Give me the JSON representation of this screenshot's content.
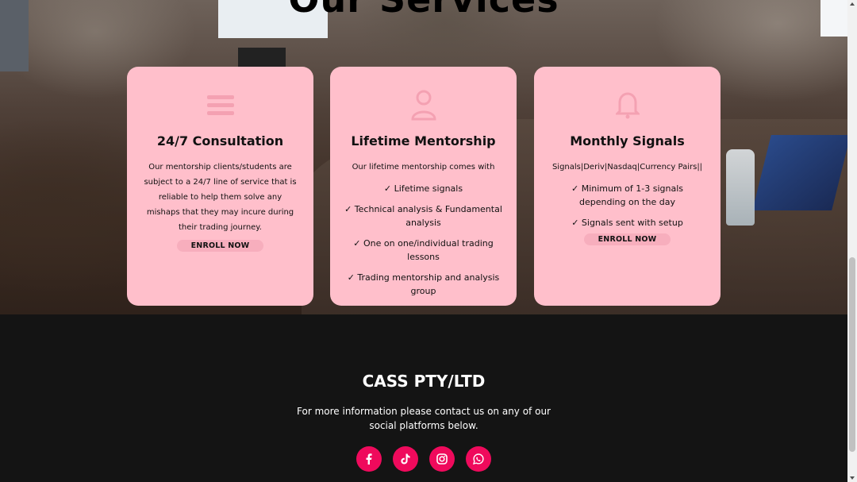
{
  "services": {
    "title": "Our Services",
    "cards": [
      {
        "icon": "menu-lines-icon",
        "heading": "24/7 Consultation",
        "description": "Our mentorship clients/students are subject to a 24/7 line of service that is reliable to help them solve any mishaps that they may incure during their trading journey.",
        "button": "ENROLL NOW"
      },
      {
        "icon": "user-icon",
        "heading": "Lifetime Mentorship",
        "intro": "Our lifetime mentorship comes with",
        "items": [
          "✓ Lifetime signals",
          "✓ Technical analysis & Fundamental analysis",
          "✓ One on one/individual trading lessons",
          "✓ Trading mentorship and analysis group"
        ]
      },
      {
        "icon": "bell-icon",
        "heading": "Monthly Signals",
        "intro": "Signals|Deriv|Nasdaq|Currency Pairs||",
        "items": [
          "✓ Minimum of 1-3 signals depending on the day",
          "✓ Signals sent with setup"
        ],
        "button": "ENROLL NOW"
      }
    ]
  },
  "footer": {
    "brand": "CASS PTY/LTD",
    "info": "For more information please contact us on any of our social platforms below.",
    "social_icons": [
      "facebook-icon",
      "tiktok-icon",
      "instagram-icon",
      "whatsapp-icon"
    ],
    "accent_color": "#ef0a5c"
  },
  "colors": {
    "card_background": "#ffbfcb",
    "footer_background": "#141414"
  }
}
